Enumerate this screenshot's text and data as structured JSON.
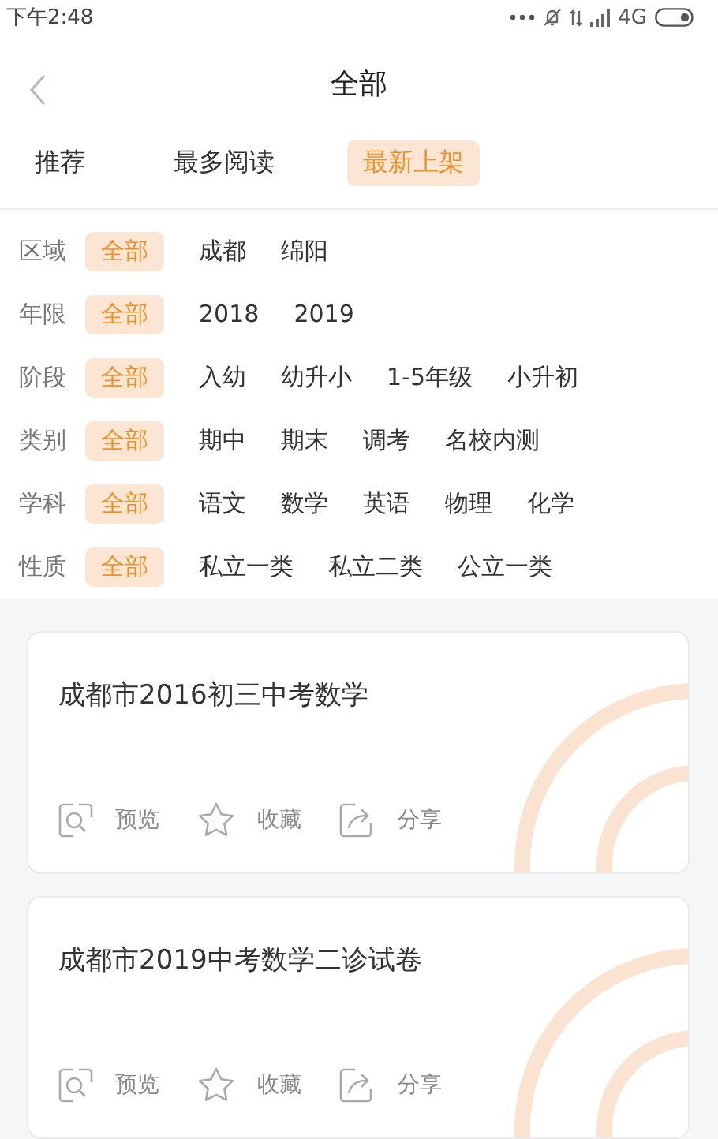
{
  "status_bar": {
    "time": "下午2:48",
    "network": "4G"
  },
  "header": {
    "title": "全部"
  },
  "tabs": [
    {
      "label": "推荐",
      "selected": false
    },
    {
      "label": "最多阅读",
      "selected": false
    },
    {
      "label": "最新上架",
      "selected": true
    }
  ],
  "filters": [
    {
      "label": "区域",
      "options": [
        {
          "label": "全部",
          "selected": true
        },
        {
          "label": "成都",
          "selected": false
        },
        {
          "label": "绵阳",
          "selected": false
        }
      ]
    },
    {
      "label": "年限",
      "options": [
        {
          "label": "全部",
          "selected": true
        },
        {
          "label": "2018",
          "selected": false
        },
        {
          "label": "2019",
          "selected": false
        }
      ]
    },
    {
      "label": "阶段",
      "options": [
        {
          "label": "全部",
          "selected": true
        },
        {
          "label": "入幼",
          "selected": false
        },
        {
          "label": "幼升小",
          "selected": false
        },
        {
          "label": "1-5年级",
          "selected": false
        },
        {
          "label": "小升初",
          "selected": false
        }
      ]
    },
    {
      "label": "类别",
      "options": [
        {
          "label": "全部",
          "selected": true
        },
        {
          "label": "期中",
          "selected": false
        },
        {
          "label": "期末",
          "selected": false
        },
        {
          "label": "调考",
          "selected": false
        },
        {
          "label": "名校内测",
          "selected": false
        }
      ]
    },
    {
      "label": "学科",
      "options": [
        {
          "label": "全部",
          "selected": true
        },
        {
          "label": "语文",
          "selected": false
        },
        {
          "label": "数学",
          "selected": false
        },
        {
          "label": "英语",
          "selected": false
        },
        {
          "label": "物理",
          "selected": false
        },
        {
          "label": "化学",
          "selected": false
        }
      ]
    },
    {
      "label": "性质",
      "options": [
        {
          "label": "全部",
          "selected": true
        },
        {
          "label": "私立一类",
          "selected": false
        },
        {
          "label": "私立二类",
          "selected": false
        },
        {
          "label": "公立一类",
          "selected": false
        }
      ]
    }
  ],
  "cards": [
    {
      "title": "成都市2016初三中考数学",
      "actions": [
        {
          "kind": "preview",
          "label": "预览"
        },
        {
          "kind": "favorite",
          "label": "收藏"
        },
        {
          "kind": "share",
          "label": "分享"
        }
      ]
    },
    {
      "title": "成都市2019中考数学二诊试卷",
      "actions": [
        {
          "kind": "preview",
          "label": "预览"
        },
        {
          "kind": "favorite",
          "label": "收藏"
        },
        {
          "kind": "share",
          "label": "分享"
        }
      ]
    }
  ]
}
